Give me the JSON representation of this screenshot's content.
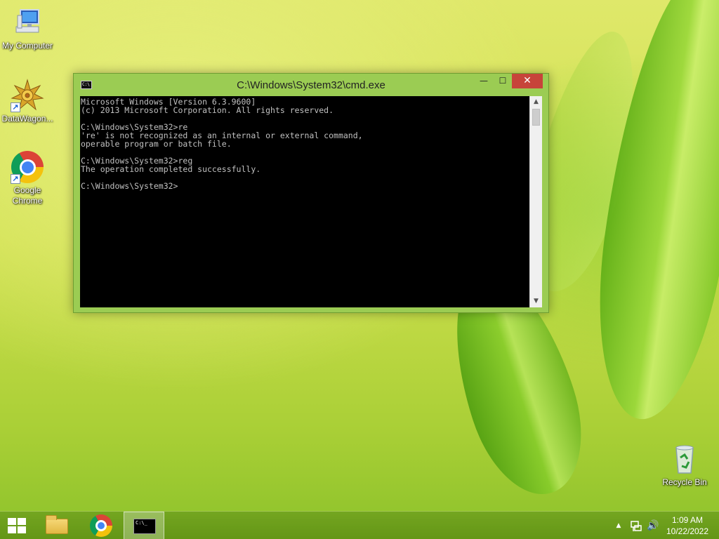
{
  "desktop": {
    "icons": [
      {
        "label": "My Computer",
        "icon": "computer-icon"
      },
      {
        "label": "DataWagon...",
        "icon": "datawagon-icon"
      },
      {
        "label": "Google Chrome",
        "icon": "chrome-icon"
      },
      {
        "label": "Recycle Bin",
        "icon": "recycle-bin-icon"
      }
    ]
  },
  "window": {
    "title": "C:\\Windows\\System32\\cmd.exe",
    "minimize_glyph": "—",
    "maximize_glyph": "☐",
    "close_glyph": "✕",
    "console_lines": [
      "Microsoft Windows [Version 6.3.9600]",
      "(c) 2013 Microsoft Corporation. All rights reserved.",
      "",
      "C:\\Windows\\System32>re",
      "'re' is not recognized as an internal or external command,",
      "operable program or batch file.",
      "",
      "C:\\Windows\\System32>reg",
      "The operation completed successfully.",
      "",
      "C:\\Windows\\System32>"
    ]
  },
  "taskbar": {
    "pinned": [
      {
        "name": "start-button",
        "icon": "windows-logo-icon"
      },
      {
        "name": "file-explorer",
        "icon": "folder-icon"
      },
      {
        "name": "google-chrome",
        "icon": "chrome-icon"
      },
      {
        "name": "command-prompt",
        "icon": "cmd-icon",
        "active": true
      }
    ],
    "tray": {
      "show_hidden_glyph": "▲",
      "volume_glyph": "🔊"
    },
    "clock": {
      "time": "1:09 AM",
      "date": "10/22/2022"
    }
  },
  "colors": {
    "window_frame": "#9bcc53",
    "close_button": "#c7443a",
    "console_bg": "#000000",
    "console_text": "#c0c0c0"
  }
}
